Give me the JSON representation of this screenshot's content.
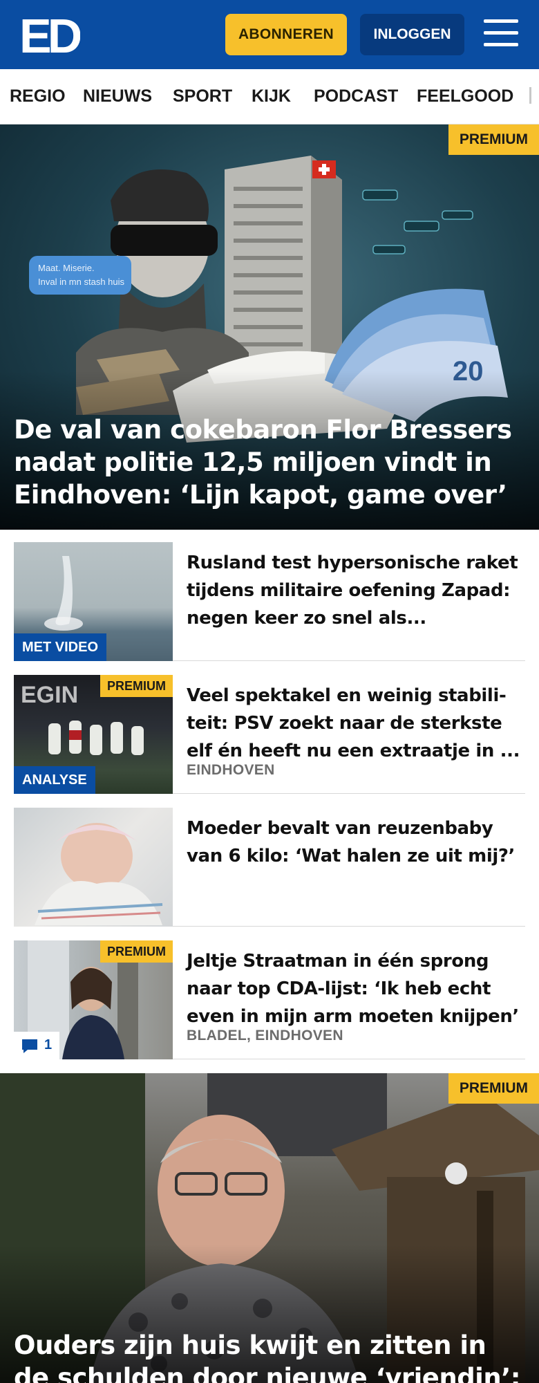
{
  "header": {
    "logo_text": "ED",
    "subscribe_label": "ABONNEREN",
    "login_label": "INLOGGEN",
    "menu_icon": "hamburger-menu-icon",
    "brand_color": "#0a4da2",
    "accent_color": "#f7c02b"
  },
  "nav": {
    "items": [
      "REGIO",
      "NIEUWS",
      "SPORT",
      "KIJK",
      "PODCAST",
      "FEELGOOD"
    ]
  },
  "hero": {
    "badge": "PREMIUM",
    "title": "De val van cokebaron Flor Bressers nadat politie 12,5 miljoen vindt in Eindhoven: ‘Lijn kapot, game over’",
    "chat_bubble": "Maat. Miserie. Inval in mn stash huis",
    "banknote_value": "20"
  },
  "articles": [
    {
      "title": "Rusland test hypersonische raket tijdens militaire oefening Zapad: negen keer zo snel als...",
      "label": "MET VIDEO",
      "location": ""
    },
    {
      "title": "Veel spektakel en weinig stabili-teit: PSV zoekt naar de sterkste elf én heeft nu een extraatje in ...",
      "label": "ANALYSE",
      "premium": "PREMIUM",
      "location": "EINDHOVEN"
    },
    {
      "title": "Moeder bevalt van reuzenbaby van 6 kilo: ‘Wat halen ze uit mij?’",
      "location": ""
    },
    {
      "title": "Jeltje Straatman in één sprong naar top CDA-lijst: ‘Ik heb echt even in mijn arm moeten knijpen’",
      "premium": "PREMIUM",
      "comments": "1",
      "location": "BLADEL, EINDHOVEN"
    }
  ],
  "hero2": {
    "badge": "PREMIUM",
    "title": "Ouders zijn huis kwijt en zitten in de schulden door nieuwe ‘vriendin’: ‘We..."
  }
}
